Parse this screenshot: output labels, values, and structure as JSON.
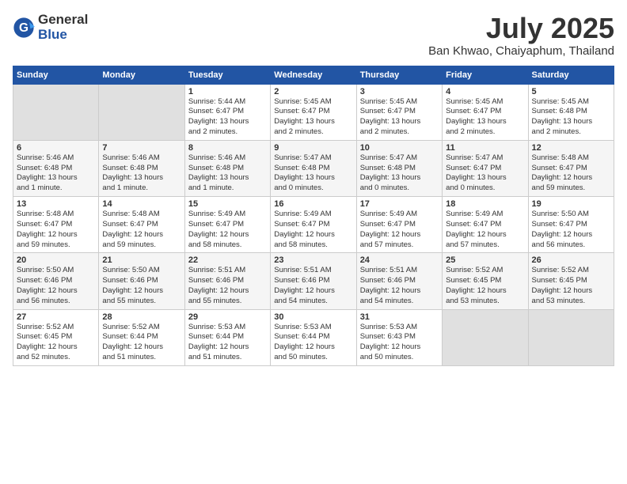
{
  "header": {
    "logo_general": "General",
    "logo_blue": "Blue",
    "month_title": "July 2025",
    "location": "Ban Khwao, Chaiyaphum, Thailand"
  },
  "weekdays": [
    "Sunday",
    "Monday",
    "Tuesday",
    "Wednesday",
    "Thursday",
    "Friday",
    "Saturday"
  ],
  "weeks": [
    {
      "days": [
        {
          "num": "",
          "info": ""
        },
        {
          "num": "",
          "info": ""
        },
        {
          "num": "1",
          "info": "Sunrise: 5:44 AM\nSunset: 6:47 PM\nDaylight: 13 hours\nand 2 minutes."
        },
        {
          "num": "2",
          "info": "Sunrise: 5:45 AM\nSunset: 6:47 PM\nDaylight: 13 hours\nand 2 minutes."
        },
        {
          "num": "3",
          "info": "Sunrise: 5:45 AM\nSunset: 6:47 PM\nDaylight: 13 hours\nand 2 minutes."
        },
        {
          "num": "4",
          "info": "Sunrise: 5:45 AM\nSunset: 6:47 PM\nDaylight: 13 hours\nand 2 minutes."
        },
        {
          "num": "5",
          "info": "Sunrise: 5:45 AM\nSunset: 6:48 PM\nDaylight: 13 hours\nand 2 minutes."
        }
      ]
    },
    {
      "days": [
        {
          "num": "6",
          "info": "Sunrise: 5:46 AM\nSunset: 6:48 PM\nDaylight: 13 hours\nand 1 minute."
        },
        {
          "num": "7",
          "info": "Sunrise: 5:46 AM\nSunset: 6:48 PM\nDaylight: 13 hours\nand 1 minute."
        },
        {
          "num": "8",
          "info": "Sunrise: 5:46 AM\nSunset: 6:48 PM\nDaylight: 13 hours\nand 1 minute."
        },
        {
          "num": "9",
          "info": "Sunrise: 5:47 AM\nSunset: 6:48 PM\nDaylight: 13 hours\nand 0 minutes."
        },
        {
          "num": "10",
          "info": "Sunrise: 5:47 AM\nSunset: 6:48 PM\nDaylight: 13 hours\nand 0 minutes."
        },
        {
          "num": "11",
          "info": "Sunrise: 5:47 AM\nSunset: 6:47 PM\nDaylight: 13 hours\nand 0 minutes."
        },
        {
          "num": "12",
          "info": "Sunrise: 5:48 AM\nSunset: 6:47 PM\nDaylight: 12 hours\nand 59 minutes."
        }
      ]
    },
    {
      "days": [
        {
          "num": "13",
          "info": "Sunrise: 5:48 AM\nSunset: 6:47 PM\nDaylight: 12 hours\nand 59 minutes."
        },
        {
          "num": "14",
          "info": "Sunrise: 5:48 AM\nSunset: 6:47 PM\nDaylight: 12 hours\nand 59 minutes."
        },
        {
          "num": "15",
          "info": "Sunrise: 5:49 AM\nSunset: 6:47 PM\nDaylight: 12 hours\nand 58 minutes."
        },
        {
          "num": "16",
          "info": "Sunrise: 5:49 AM\nSunset: 6:47 PM\nDaylight: 12 hours\nand 58 minutes."
        },
        {
          "num": "17",
          "info": "Sunrise: 5:49 AM\nSunset: 6:47 PM\nDaylight: 12 hours\nand 57 minutes."
        },
        {
          "num": "18",
          "info": "Sunrise: 5:49 AM\nSunset: 6:47 PM\nDaylight: 12 hours\nand 57 minutes."
        },
        {
          "num": "19",
          "info": "Sunrise: 5:50 AM\nSunset: 6:47 PM\nDaylight: 12 hours\nand 56 minutes."
        }
      ]
    },
    {
      "days": [
        {
          "num": "20",
          "info": "Sunrise: 5:50 AM\nSunset: 6:46 PM\nDaylight: 12 hours\nand 56 minutes."
        },
        {
          "num": "21",
          "info": "Sunrise: 5:50 AM\nSunset: 6:46 PM\nDaylight: 12 hours\nand 55 minutes."
        },
        {
          "num": "22",
          "info": "Sunrise: 5:51 AM\nSunset: 6:46 PM\nDaylight: 12 hours\nand 55 minutes."
        },
        {
          "num": "23",
          "info": "Sunrise: 5:51 AM\nSunset: 6:46 PM\nDaylight: 12 hours\nand 54 minutes."
        },
        {
          "num": "24",
          "info": "Sunrise: 5:51 AM\nSunset: 6:46 PM\nDaylight: 12 hours\nand 54 minutes."
        },
        {
          "num": "25",
          "info": "Sunrise: 5:52 AM\nSunset: 6:45 PM\nDaylight: 12 hours\nand 53 minutes."
        },
        {
          "num": "26",
          "info": "Sunrise: 5:52 AM\nSunset: 6:45 PM\nDaylight: 12 hours\nand 53 minutes."
        }
      ]
    },
    {
      "days": [
        {
          "num": "27",
          "info": "Sunrise: 5:52 AM\nSunset: 6:45 PM\nDaylight: 12 hours\nand 52 minutes."
        },
        {
          "num": "28",
          "info": "Sunrise: 5:52 AM\nSunset: 6:44 PM\nDaylight: 12 hours\nand 51 minutes."
        },
        {
          "num": "29",
          "info": "Sunrise: 5:53 AM\nSunset: 6:44 PM\nDaylight: 12 hours\nand 51 minutes."
        },
        {
          "num": "30",
          "info": "Sunrise: 5:53 AM\nSunset: 6:44 PM\nDaylight: 12 hours\nand 50 minutes."
        },
        {
          "num": "31",
          "info": "Sunrise: 5:53 AM\nSunset: 6:43 PM\nDaylight: 12 hours\nand 50 minutes."
        },
        {
          "num": "",
          "info": ""
        },
        {
          "num": "",
          "info": ""
        }
      ]
    }
  ]
}
